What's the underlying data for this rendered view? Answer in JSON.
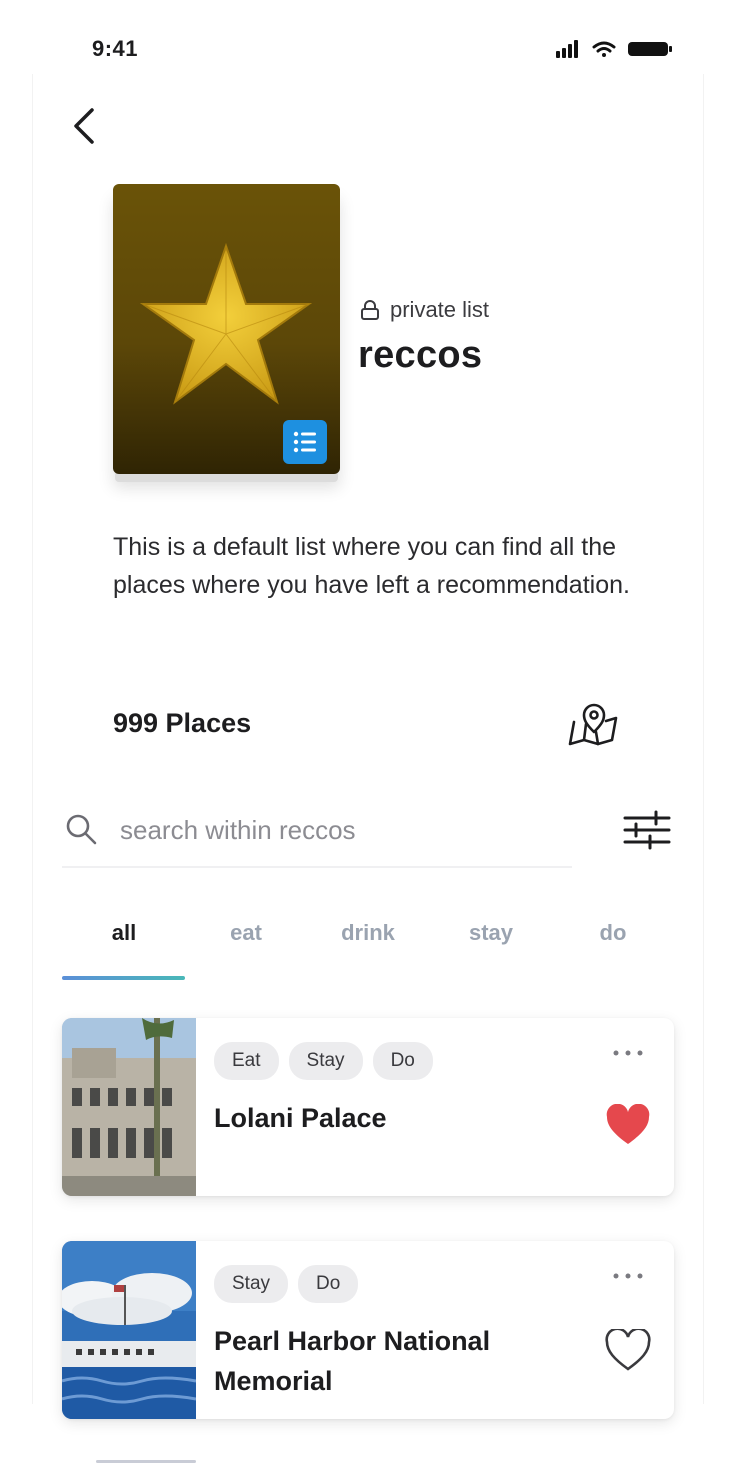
{
  "status_bar": {
    "time": "9:41"
  },
  "list": {
    "privacy_label": "private list",
    "title": "reccos",
    "description": "This is a default list where you can find all the places where you have left a recommendation.",
    "places_count": "999 Places"
  },
  "search": {
    "placeholder": "search within reccos"
  },
  "tabs": [
    {
      "label": "all",
      "active": true
    },
    {
      "label": "eat",
      "active": false
    },
    {
      "label": "drink",
      "active": false
    },
    {
      "label": "stay",
      "active": false
    },
    {
      "label": "do",
      "active": false
    }
  ],
  "places": [
    {
      "name": "Lolani Palace",
      "tags": [
        "Eat",
        "Stay",
        "Do"
      ],
      "favorited": true
    },
    {
      "name": "Pearl Harbor National Memorial",
      "tags": [
        "Stay",
        "Do"
      ],
      "favorited": false
    }
  ],
  "colors": {
    "accent_blue": "#1e90e0",
    "heart_red": "#e5484d",
    "cover_gold": "#6a5308"
  },
  "icons": [
    "back-arrow-icon",
    "lock-icon",
    "list-icon",
    "map-pin-icon",
    "search-icon",
    "sliders-icon",
    "more-icon",
    "heart-icon"
  ]
}
